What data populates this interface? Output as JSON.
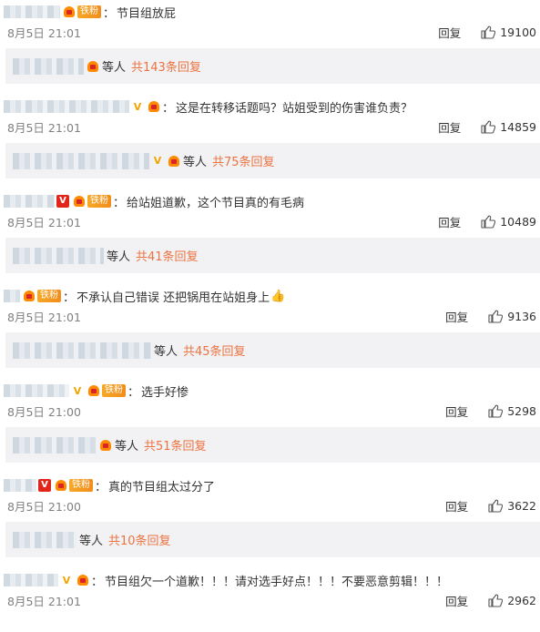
{
  "comments": [
    {
      "comment": "节目组放屁",
      "time": "8月5日 21:01",
      "reply": "回复",
      "likes": "19100",
      "thread_others": "等人",
      "thread_count": "共143条回复",
      "fan_tag": "铁粉",
      "verified": "none"
    },
    {
      "comment": "这是在转移话题吗？站姐受到的伤害谁负责？",
      "time": "8月5日 21:01",
      "reply": "回复",
      "likes": "14859",
      "thread_others": "等人",
      "thread_count": "共75条回复",
      "fan_tag": "",
      "verified": "gold"
    },
    {
      "comment": "给站姐道歉，这个节目真的有毛病",
      "time": "8月5日 21:01",
      "reply": "回复",
      "likes": "10489",
      "thread_others": "等人",
      "thread_count": "共41条回复",
      "fan_tag": "铁粉",
      "verified": "red"
    },
    {
      "comment": "不承认自己错误 还把锅甩在站姐身上",
      "time": "8月5日 21:01",
      "reply": "回复",
      "likes": "9136",
      "thread_others": "等人",
      "thread_count": "共45条回复",
      "fan_tag": "铁粉",
      "verified": "none"
    },
    {
      "comment": "选手好惨",
      "time": "8月5日 21:00",
      "reply": "回复",
      "likes": "5298",
      "thread_others": "等人",
      "thread_count": "共51条回复",
      "fan_tag": "铁粉",
      "verified": "gold"
    },
    {
      "comment": "真的节目组太过分了",
      "time": "8月5日 21:00",
      "reply": "回复",
      "likes": "3622",
      "thread_others": "等人",
      "thread_count": "共10条回复",
      "fan_tag": "铁粉",
      "verified": "red"
    },
    {
      "comment": "节目组欠一个道歉！！！请对选手好点！！！不要恶意剪辑！！！",
      "time": "8月5日 21:01",
      "reply": "回复",
      "likes": "2962",
      "thread_others": "",
      "thread_count": "",
      "fan_tag": "",
      "verified": "gold"
    }
  ],
  "icons": {
    "like": "thumbs-up-icon",
    "fan": "fan-heart-icon",
    "verified": "verified-v-icon",
    "thumb_emoji": "thumbs-up-emoji"
  },
  "colors": {
    "reply_count": "#eb7340",
    "meta": "#808080",
    "thread_bg": "#f2f2f5",
    "verified_gold": "#f0a500",
    "verified_red": "#e1251b"
  }
}
